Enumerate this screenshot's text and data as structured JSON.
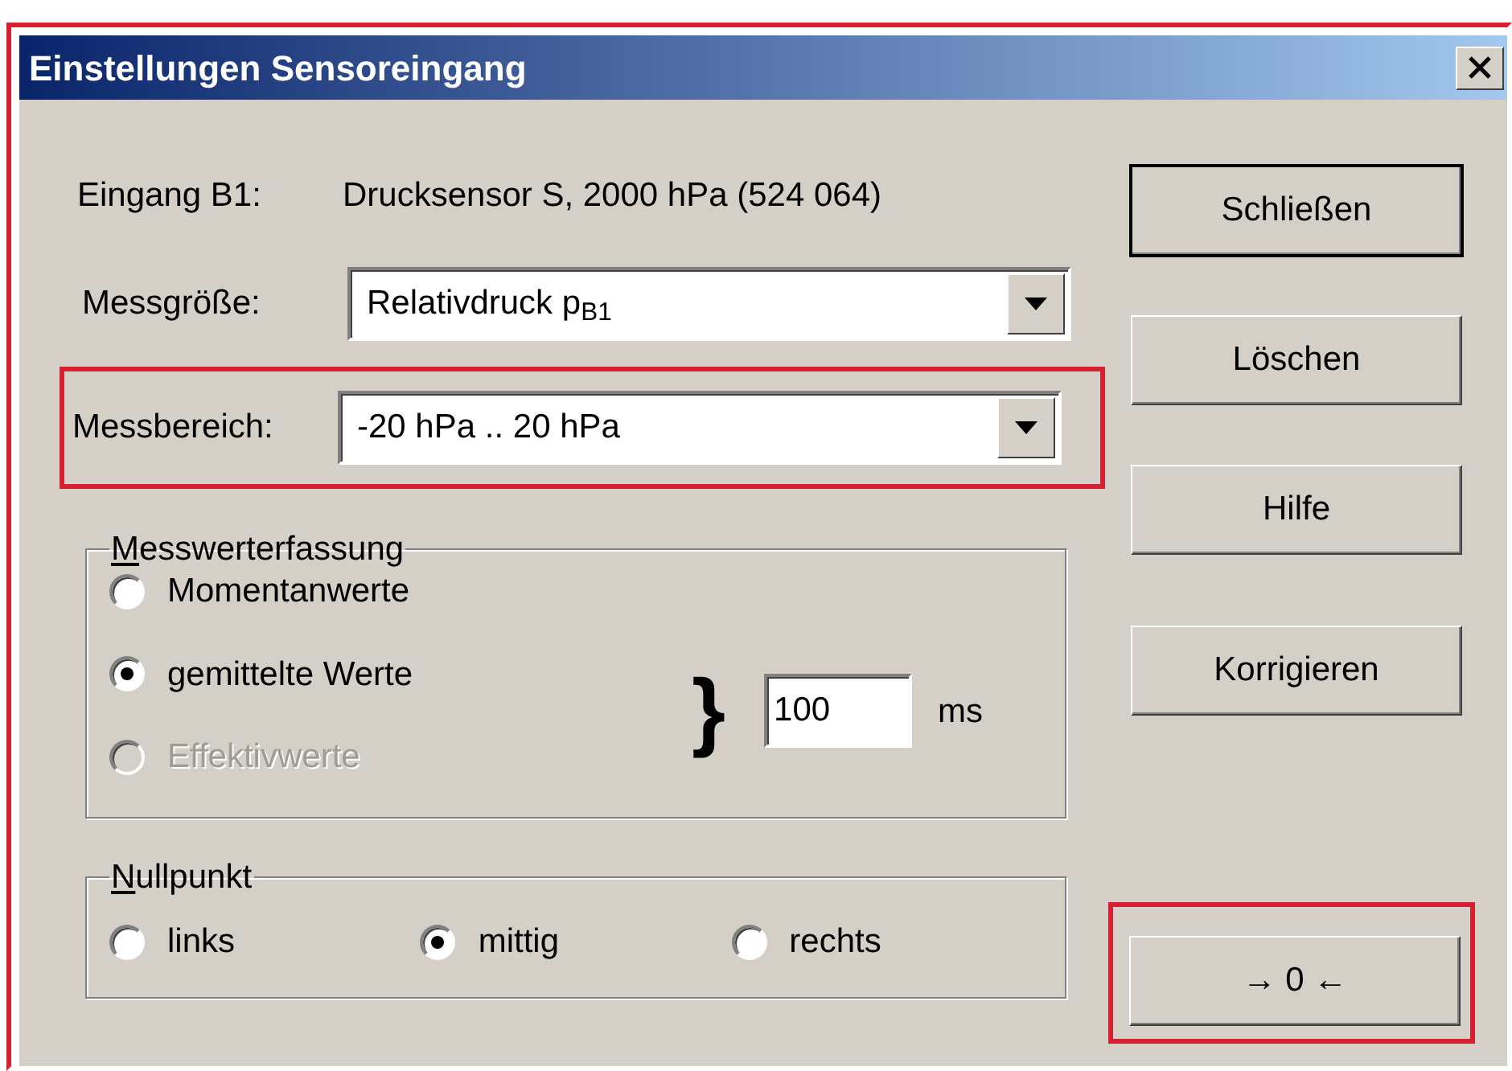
{
  "frame_highlighted": true,
  "window": {
    "title": "Einstellungen Sensoreingang"
  },
  "input_row": {
    "label": "Eingang B1:",
    "value": "Drucksensor S, 2000 hPa (524 064)"
  },
  "fields": [
    {
      "label": "Messgröße:",
      "value": "Relativdruck p$_{B1}$",
      "highlighted": false
    },
    {
      "label": "Messbereich:",
      "value": "-20 hPa .. 20 hPa",
      "highlighted": true
    }
  ],
  "acquisition": {
    "title": "Messwerterfassung",
    "options": [
      {
        "label": "Momentanwerte",
        "selected": false,
        "disabled": false
      },
      {
        "label": "gemittelte Werte",
        "selected": true,
        "disabled": false
      },
      {
        "label": "Effektivwerte",
        "selected": false,
        "disabled": true
      }
    ],
    "brace": "}",
    "interval": "100",
    "unit": "ms"
  },
  "zero_point": {
    "title": "Nullpunkt",
    "options": [
      {
        "label": "links",
        "selected": false
      },
      {
        "label": "mittig",
        "selected": true
      },
      {
        "label": "rechts",
        "selected": false
      }
    ]
  },
  "buttons": [
    {
      "label": "Schließen",
      "default": true
    },
    {
      "label": "Löschen",
      "default": false
    },
    {
      "label": "Hilfe",
      "default": false
    },
    {
      "label": "Korrigieren",
      "default": false
    }
  ],
  "zero_button": {
    "label": "→ 0 ←",
    "highlighted": true
  }
}
